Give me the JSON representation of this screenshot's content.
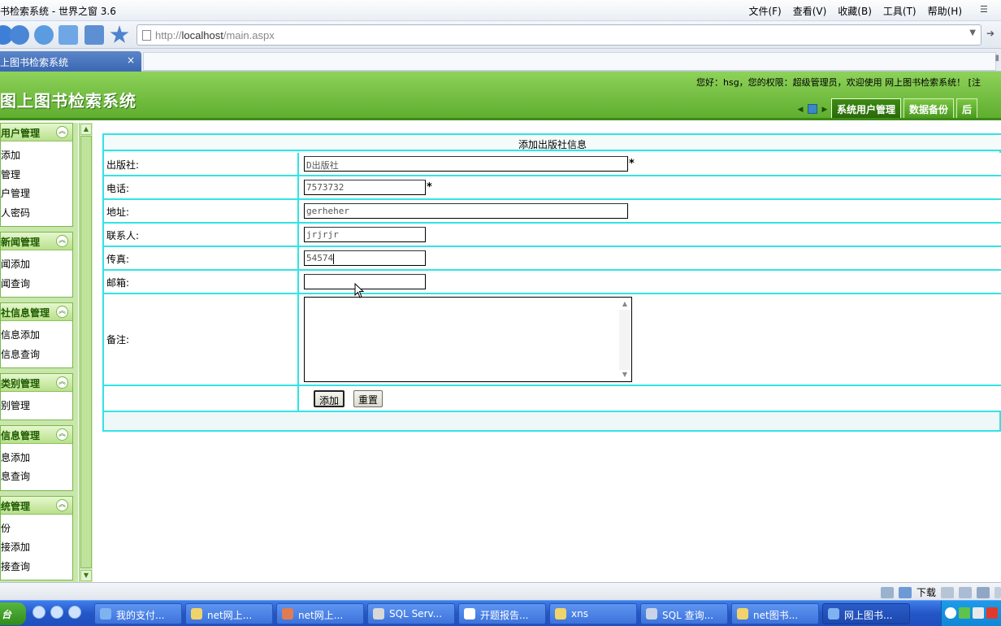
{
  "browser": {
    "window_title": "书检索系统 - 世界之窗 3.6",
    "menu": [
      "文件(F)",
      "查看(V)",
      "收藏(B)",
      "工具(T)",
      "帮助(H)"
    ],
    "address_prefix": "http://",
    "address_host": "localhost",
    "address_path": "/main.aspx",
    "tab_title": "上图书检索系统",
    "tab_close": "×"
  },
  "header": {
    "title": "图上图书检索系统",
    "welcome": "您好：hsg，您的权限：超级管理员，欢迎使用 网上图书检索系统！ [注",
    "tabs": [
      "系统用户管理",
      "数据备份",
      "后"
    ]
  },
  "sidebar": {
    "groups": [
      {
        "title": "用户管理",
        "items": [
          "添加",
          "管理",
          "户管理",
          "人密码"
        ]
      },
      {
        "title": "新闻管理",
        "items": [
          "闻添加",
          "闻查询"
        ]
      },
      {
        "title": "社信息管理",
        "items": [
          "信息添加",
          "信息查询"
        ]
      },
      {
        "title": "类别管理",
        "items": [
          "别管理"
        ]
      },
      {
        "title": "信息管理",
        "items": [
          "息添加",
          "息查询"
        ]
      },
      {
        "title": "统管理",
        "items": [
          "份",
          "接添加",
          "接查询"
        ]
      }
    ]
  },
  "form": {
    "caption": "添加出版社信息",
    "fields": {
      "publisher": {
        "label": "出版社:",
        "value": "D出版社",
        "required": "*"
      },
      "phone": {
        "label": "电话:",
        "value": "7573732",
        "required": "*"
      },
      "address": {
        "label": "地址:",
        "value": "gerheher"
      },
      "contact": {
        "label": "联系人:",
        "value": "jrjrjr"
      },
      "fax": {
        "label": "传真:",
        "value": "54574"
      },
      "email": {
        "label": "邮箱:",
        "value": ""
      },
      "remark": {
        "label": "备注:",
        "value": ""
      }
    },
    "buttons": {
      "add": "添加",
      "reset": "重置"
    }
  },
  "statusbar": {
    "download": "下载"
  },
  "taskbar": {
    "start": "台",
    "tasks": [
      "我的支付...",
      "net网上...",
      "net网上...",
      "SQL Serv...",
      "开题报告...",
      "xns",
      "SQL 查询...",
      "net图书...",
      "网上图书..."
    ],
    "active_index": 8
  },
  "colors": {
    "header_green": "#6dbb3a",
    "form_border": "#33e3e6",
    "taskbar_blue": "#2456c7"
  }
}
